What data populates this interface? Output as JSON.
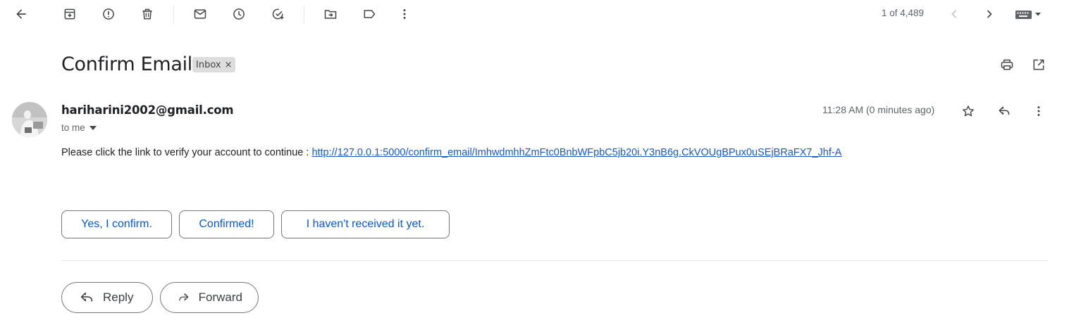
{
  "toolbar": {
    "icons": [
      "back-arrow-icon",
      "archive-icon",
      "report-spam-icon",
      "delete-icon",
      "mark-unread-icon",
      "snooze-icon",
      "add-to-tasks-icon",
      "move-to-icon",
      "label-icon",
      "more-vert-icon"
    ]
  },
  "pager": {
    "text": "1 of 4,489"
  },
  "email": {
    "subject": "Confirm Email",
    "label": "Inbox",
    "label_close": "×",
    "sender": "hariharini2002@gmail.com",
    "to": "to me",
    "time": "11:28 AM (0 minutes ago)",
    "body_prefix": "Please click the link to verify your account to continue  : ",
    "link": "http://127.0.0.1:5000/confirm_email/ImhwdmhhZmFtc0BnbWFpbC5jb20i.Y3nB6g.CkVOUgBPux0uSEjBRaFX7_Jhf-A"
  },
  "smart_replies": [
    "Yes, I confirm.",
    "Confirmed!",
    "I haven't received it yet."
  ],
  "actions": {
    "reply": "Reply",
    "forward": "Forward"
  },
  "colors": {
    "link": "#1a58c4",
    "smart_reply_text": "#0b57d0",
    "icon": "#444746"
  }
}
